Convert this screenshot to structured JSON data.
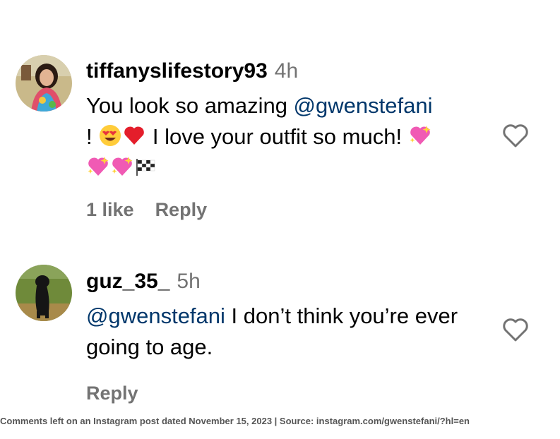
{
  "comments": [
    {
      "username": "tiffanyslifestory93",
      "time": "4h",
      "text_before": "You look so amazing ",
      "mention": "@gwenstefani",
      "text_after": "! ",
      "text_mid": " I love your outfit so much! ",
      "emojis": [
        "smiling-face-with-heart-eyes-emoji",
        "red-heart-emoji",
        "sparkling-heart-emoji",
        "sparkling-heart-emoji",
        "sparkling-heart-emoji",
        "chequered-flag-emoji"
      ],
      "likes": "1 like",
      "reply": "Reply"
    },
    {
      "username": "guz_35_",
      "time": "5h",
      "mention": "@gwenstefani",
      "text_after": " I don’t think you’re ever going to age.",
      "reply": "Reply"
    }
  ],
  "caption": "Comments left on an Instagram post dated November 15, 2023 | Source: instagram.com/gwenstefani/?hl=en",
  "colors": {
    "mention": "#00376b",
    "secondary_text": "#737373"
  }
}
